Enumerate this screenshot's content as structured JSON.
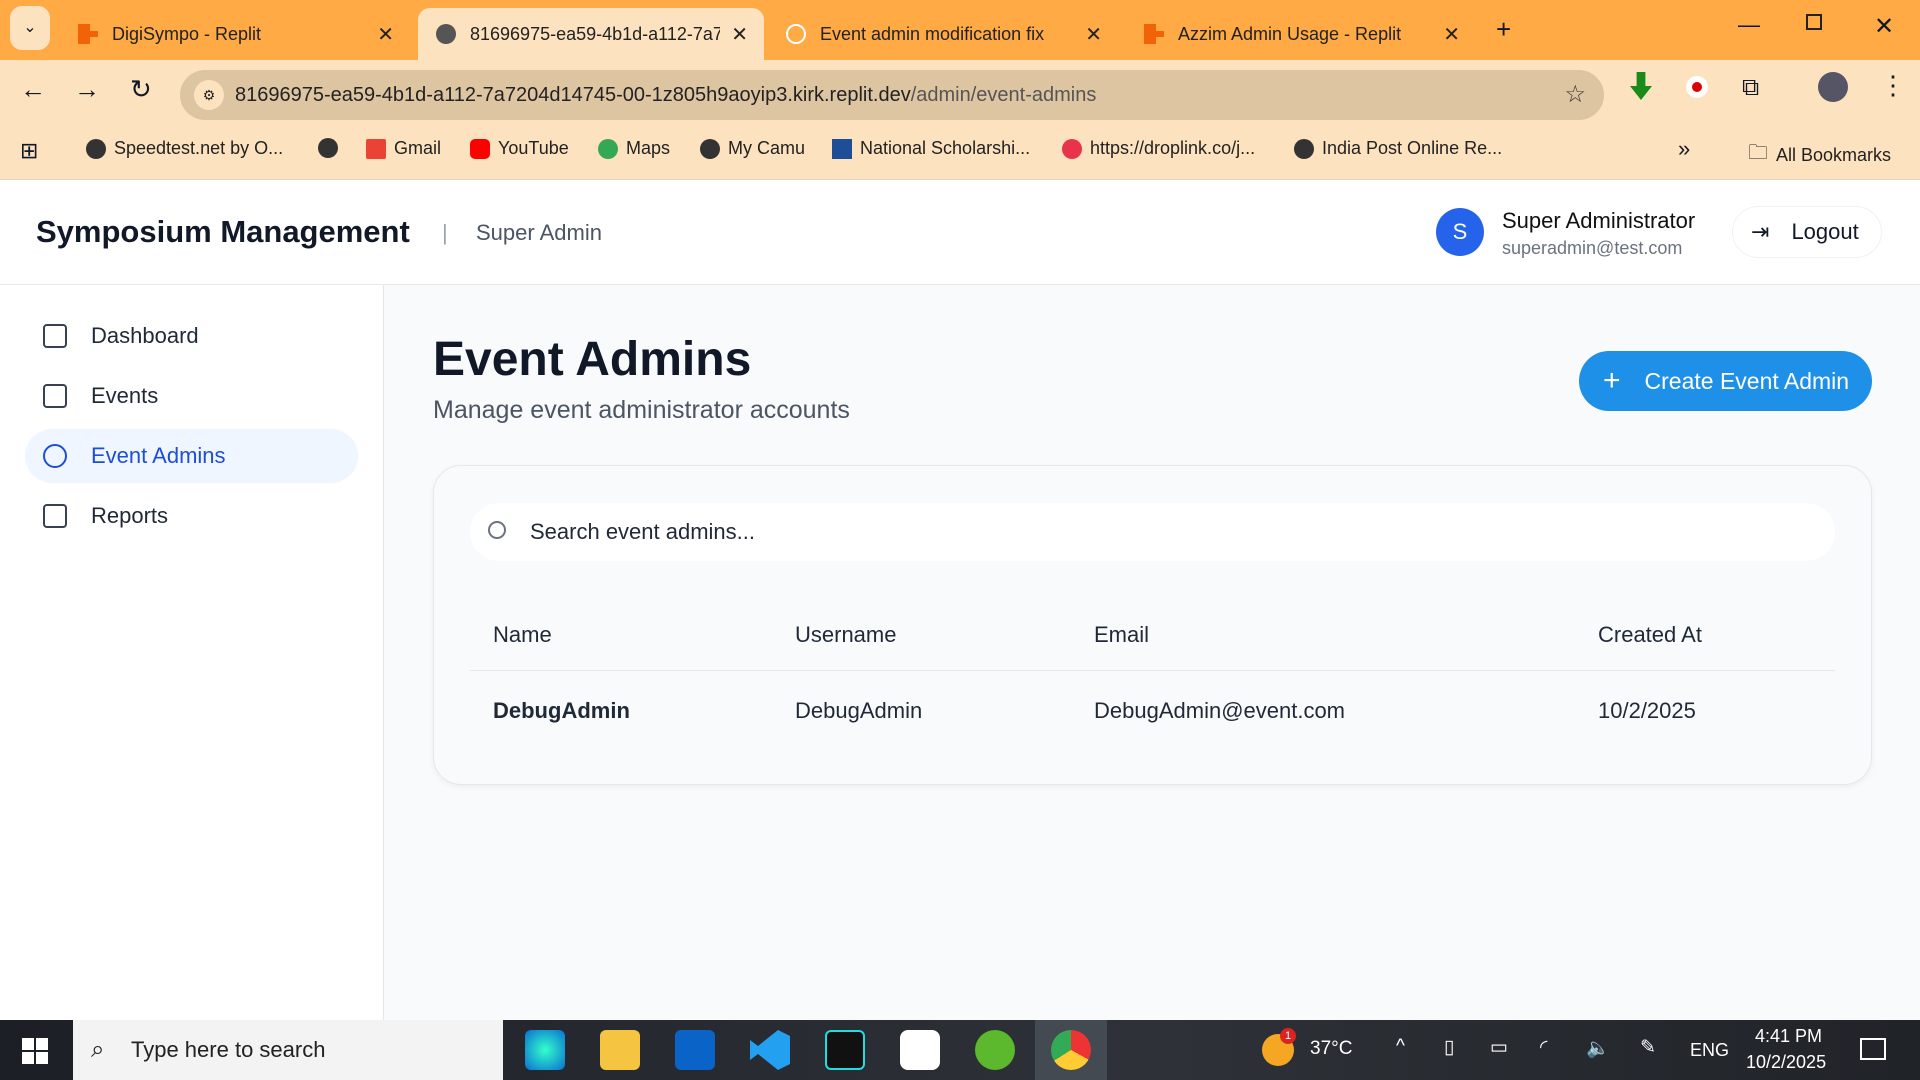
{
  "browser": {
    "tabs": [
      {
        "title": "DigiSympo - Replit",
        "active": false
      },
      {
        "title": "81696975-ea59-4b1d-a112-7a7",
        "active": true
      },
      {
        "title": "Event admin modification fix",
        "active": false
      },
      {
        "title": "Azzim Admin Usage - Replit",
        "active": false
      }
    ],
    "new_tab": "+",
    "url_host": "81696975-ea59-4b1d-a112-7a7204d14745-00-1z805h9aoyip3.kirk.replit.dev",
    "url_path": "/admin/event-admins",
    "bookmarks": [
      "Speedtest.net by O...",
      "Gmail",
      "YouTube",
      "Maps",
      "My Camu",
      "National Scholarshi...",
      "https://droplink.co/j...",
      "India Post Online Re..."
    ],
    "all_bookmarks": "All Bookmarks"
  },
  "header": {
    "title": "Symposium Management",
    "separator": "|",
    "role": "Super Admin",
    "avatar": "S",
    "user_name": "Super Administrator",
    "user_email": "superadmin@test.com",
    "logout": "Logout"
  },
  "sidebar": {
    "items": [
      {
        "label": "Dashboard"
      },
      {
        "label": "Events"
      },
      {
        "label": "Event Admins",
        "active": true
      },
      {
        "label": "Reports"
      }
    ]
  },
  "main": {
    "title": "Event Admins",
    "subtitle": "Manage event administrator accounts",
    "create_button": "Create Event Admin",
    "search_placeholder": "Search event admins...",
    "columns": [
      "Name",
      "Username",
      "Email",
      "Created At"
    ],
    "rows": [
      [
        "DebugAdmin",
        "DebugAdmin",
        "DebugAdmin@event.com",
        "10/2/2025"
      ]
    ]
  },
  "taskbar": {
    "search_placeholder": "Type here to search",
    "weather": "37°C",
    "weather_badge": "1",
    "lang": "ENG",
    "time": "4:41 PM",
    "date": "10/2/2025"
  },
  "colors": {
    "accent": "#1E90E8",
    "tabbar": "#FFAA44",
    "toolbar": "#FDE2BF"
  }
}
